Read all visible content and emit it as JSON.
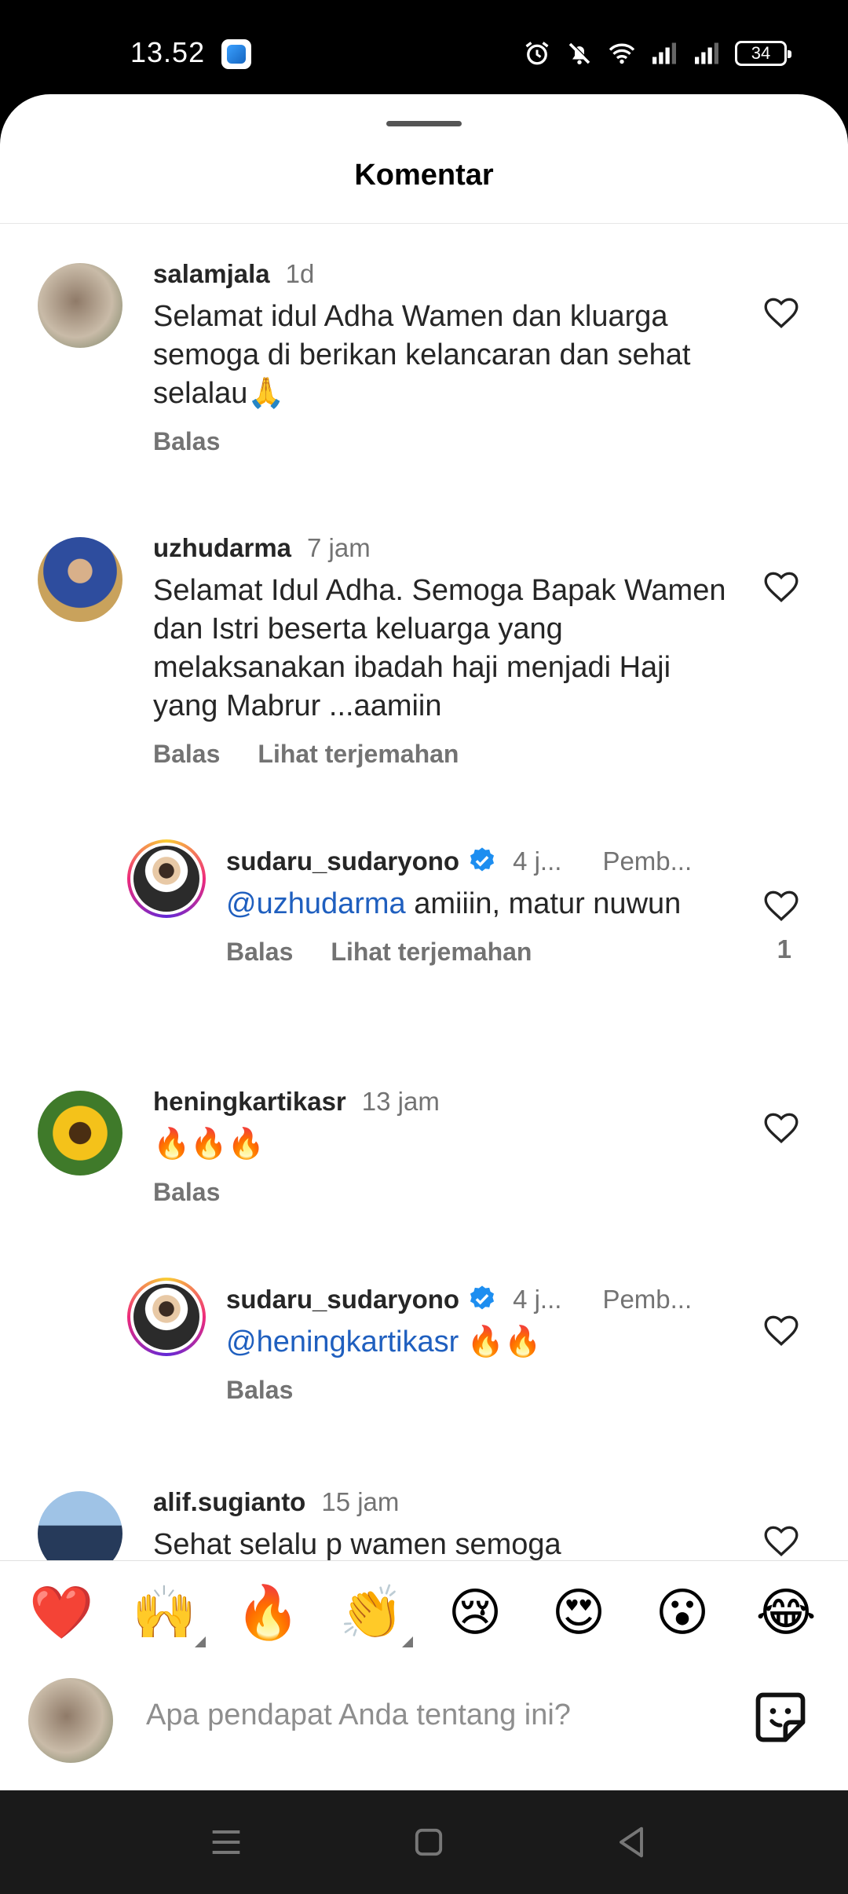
{
  "status_bar": {
    "time": "13.52",
    "battery": "34"
  },
  "sheet": {
    "title": "Komentar"
  },
  "comments": [
    {
      "username": "salamjala",
      "time": "1d",
      "text": "Selamat idul Adha Wamen dan kluarga semoga di berikan kelancaran dan sehat selalau🙏",
      "reply_label": "Balas"
    },
    {
      "username": "uzhudarma",
      "time": "7 jam",
      "text": "Selamat Idul Adha. Semoga Bapak Wamen dan Istri beserta keluarga yang melaksanakan ibadah haji menjadi Haji yang Mabrur ...aamiin",
      "reply_label": "Balas",
      "translate_label": "Lihat terjemahan"
    },
    {
      "username": "sudaru_sudaryono",
      "time": "4 j...",
      "pinned": "Pemb...",
      "mention": "@uzhudarma",
      "text": " amiiin, matur nuwun",
      "reply_label": "Balas",
      "translate_label": "Lihat terjemahan",
      "likes": "1"
    },
    {
      "username": "heningkartikasr",
      "time": "13 jam",
      "text": "🔥🔥🔥",
      "reply_label": "Balas"
    },
    {
      "username": "sudaru_sudaryono",
      "time": "4 j...",
      "pinned": "Pemb...",
      "mention": "@heningkartikasr",
      "text": " 🔥🔥",
      "reply_label": "Balas"
    },
    {
      "username": "alif.sugianto",
      "time": "15 jam",
      "text": "Sehat selalu p wamen semoga"
    }
  ],
  "emoji_bar": [
    "❤️",
    "🙌",
    "🔥",
    "👏",
    "😢",
    "😍",
    "😮",
    "😂"
  ],
  "composer": {
    "placeholder": "Apa pendapat Anda tentang ini?"
  },
  "colors": {
    "link": "#1f5fbf",
    "verified": "#1d8ef0",
    "muted": "#737373"
  }
}
